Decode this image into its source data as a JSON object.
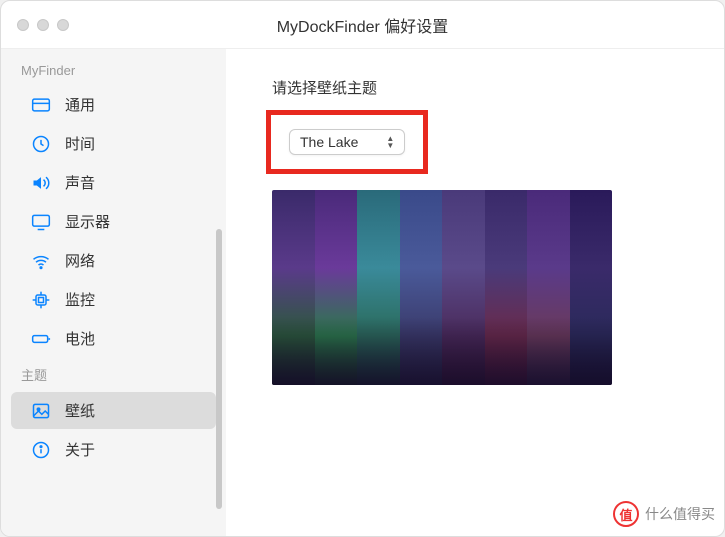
{
  "window": {
    "title": "MyDockFinder 偏好设置"
  },
  "sidebar": {
    "section1": "MyFinder",
    "section2": "主题",
    "items": [
      {
        "label": "通用"
      },
      {
        "label": "时间"
      },
      {
        "label": "声音"
      },
      {
        "label": "显示器"
      },
      {
        "label": "网络"
      },
      {
        "label": "监控"
      },
      {
        "label": "电池"
      },
      {
        "label": "壁纸"
      },
      {
        "label": "关于"
      }
    ]
  },
  "content": {
    "prompt": "请选择壁纸主题",
    "selected": "The Lake",
    "stripes": [
      "linear-gradient(to bottom,#3a2a6a,#5a3a8a 40%,#2a5a3a 75%,#1a2a2a)",
      "linear-gradient(to bottom,#4a2a7a,#6a3a9a 40%,#2a7a4a 75%,#1a3a2a)",
      "linear-gradient(to bottom,#2a6a7a,#3a8a9a 40%,#2a6a5a 75%,#1a3a3a)",
      "linear-gradient(to bottom,#3a4a8a,#4a5a9a 40%,#3a3a6a 75%,#2a2a4a)",
      "linear-gradient(to bottom,#4a3a7a,#5a4a8a 40%,#4a2a5a 75%,#3a1a3a)",
      "linear-gradient(to bottom,#3a2a6a,#4a3a7a 40%,#6a2a4a 75%,#4a1a3a)",
      "linear-gradient(to bottom,#4a2a7a,#5a3a8a 40%,#6a3a5a 75%,#3a2a4a)",
      "linear-gradient(to bottom,#2a1a5a,#3a2a6a 40%,#2a2a5a 75%,#1a1a3a)"
    ]
  },
  "watermark": {
    "badge": "值",
    "text": "什么值得买"
  }
}
